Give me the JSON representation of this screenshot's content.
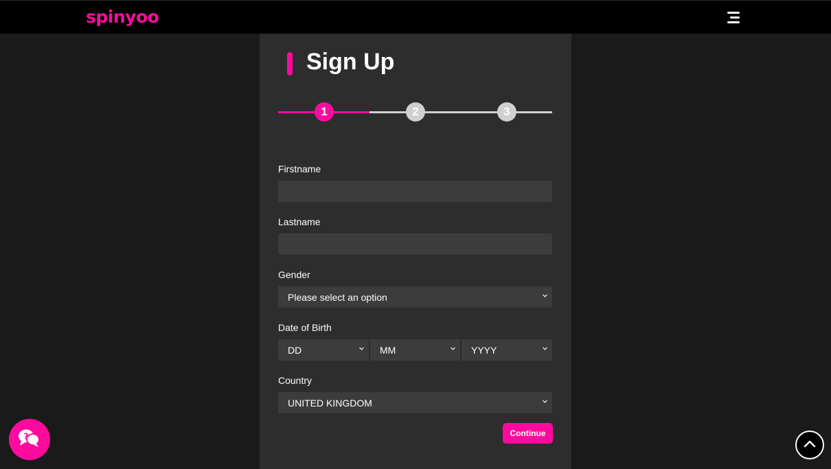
{
  "colors": {
    "accent": "#ff0a9e",
    "inactive_step": "#d0d0d0",
    "header_bg": "#000000",
    "panel_bg": "#2d2d2d",
    "field_bg": "#3c3c3c"
  },
  "header": {
    "logo_text": "spinyoo",
    "menu_icon": "hamburger-menu-icon"
  },
  "signup": {
    "title": "Sign Up",
    "steps": [
      "1",
      "2",
      "3"
    ],
    "current_step": 1,
    "fields": {
      "firstname": {
        "label": "Firstname",
        "value": "",
        "placeholder": ""
      },
      "lastname": {
        "label": "Lastname",
        "value": "",
        "placeholder": ""
      },
      "gender": {
        "label": "Gender",
        "selected": "Please select an option"
      },
      "dob": {
        "label": "Date of Birth",
        "day": "DD",
        "month": "MM",
        "year": "YYYY"
      },
      "country": {
        "label": "Country",
        "selected": "UNITED KINGDOM"
      }
    },
    "continue_label": "Continue"
  },
  "floating": {
    "help_icon": "chat-help-icon",
    "scroll_icon": "chevron-up-icon"
  }
}
